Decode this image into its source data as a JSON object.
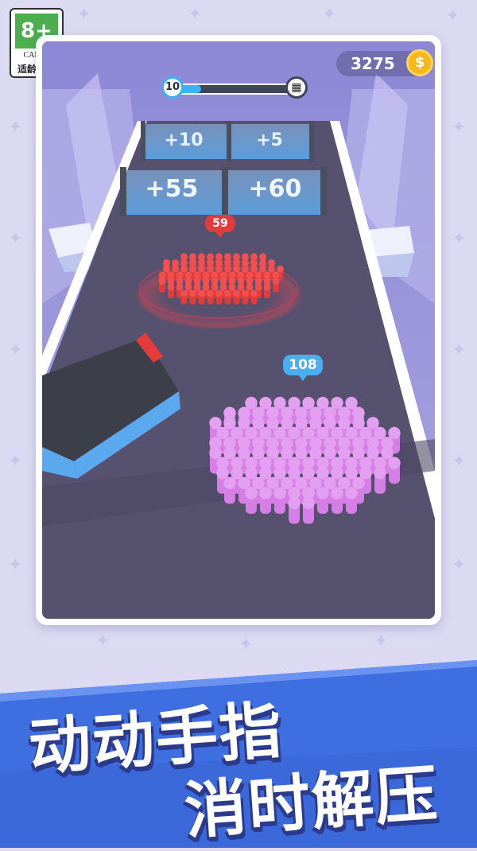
{
  "rating_badge": {
    "age": "8+",
    "org": "CADPA",
    "tip": "适龄提示",
    "color": "#4cae4f"
  },
  "hud": {
    "coins": "3275",
    "coin_icon": "coin-dollar-icon",
    "level": "10",
    "level_progress": 0.2,
    "finish_icon": "checkered-flag-icon"
  },
  "gates": {
    "far_left": "+10",
    "far_right": "+5",
    "near_left": "+55",
    "near_right": "+60"
  },
  "crowds": {
    "enemy_count": "59",
    "enemy_color": "#e13b3b",
    "player_count": "108",
    "player_color": "#d57ee6"
  },
  "banner": {
    "line1": "动动手指",
    "line2": "消时解压",
    "accent": "#3f6ee0"
  }
}
